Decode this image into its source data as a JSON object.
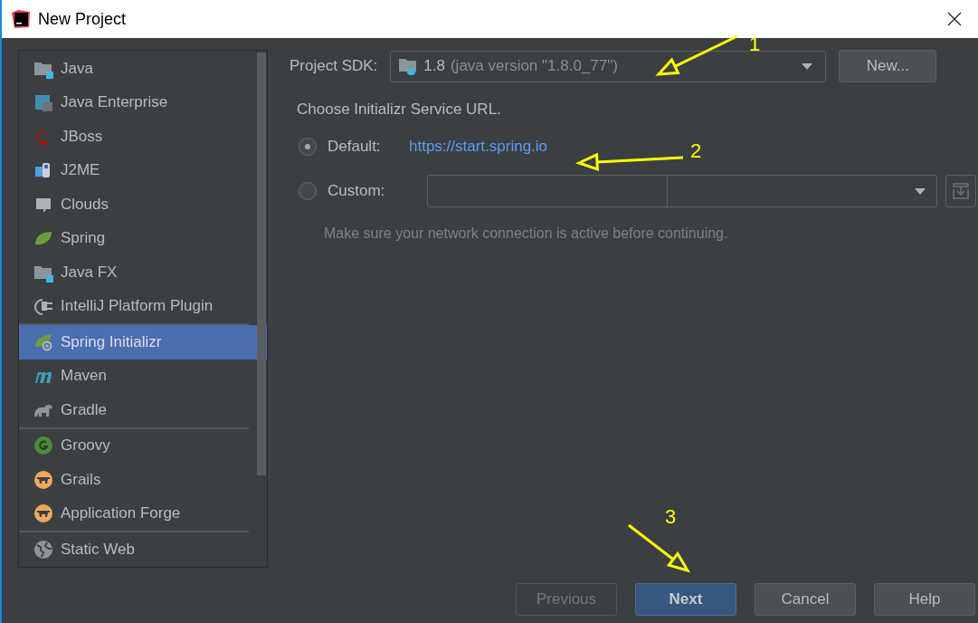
{
  "window": {
    "title": "New Project"
  },
  "sidebar": {
    "groups": [
      {
        "items": [
          {
            "label": "Java",
            "kind": "folder",
            "selected": false
          },
          {
            "label": "Java Enterprise",
            "kind": "enterprise",
            "selected": false
          },
          {
            "label": "JBoss",
            "kind": "jboss",
            "selected": false
          },
          {
            "label": "J2ME",
            "kind": "j2me",
            "selected": false
          },
          {
            "label": "Clouds",
            "kind": "clouds",
            "selected": false
          },
          {
            "label": "Spring",
            "kind": "spring",
            "selected": false
          },
          {
            "label": "Java FX",
            "kind": "folder",
            "selected": false
          },
          {
            "label": "IntelliJ Platform Plugin",
            "kind": "plugin",
            "selected": false
          }
        ]
      },
      {
        "items": [
          {
            "label": "Spring Initializr",
            "kind": "initializr",
            "selected": true
          },
          {
            "label": "Maven",
            "kind": "maven",
            "selected": false
          },
          {
            "label": "Gradle",
            "kind": "gradle",
            "selected": false
          }
        ]
      },
      {
        "items": [
          {
            "label": "Groovy",
            "kind": "groovy",
            "selected": false
          },
          {
            "label": "Grails",
            "kind": "grails",
            "selected": false
          },
          {
            "label": "Application Forge",
            "kind": "grails",
            "selected": false
          }
        ]
      },
      {
        "items": [
          {
            "label": "Static Web",
            "kind": "web",
            "selected": false
          }
        ]
      }
    ]
  },
  "sdk": {
    "label": "Project SDK:",
    "version": "1.8",
    "detail": "(java version \"1.8.0_77\")",
    "new_button": "New..."
  },
  "service_url": {
    "heading": "Choose Initializr Service URL.",
    "options": [
      {
        "label": "Default:",
        "selected": true,
        "link": "https://start.spring.io"
      },
      {
        "label": "Custom:",
        "selected": false
      }
    ],
    "hint": "Make sure your network connection is active before continuing."
  },
  "buttons": [
    {
      "label": "Previous",
      "kind": "disabled"
    },
    {
      "label": "Next",
      "kind": "default"
    },
    {
      "label": "Cancel",
      "kind": "normal"
    },
    {
      "label": "Help",
      "kind": "normal"
    }
  ],
  "annotations": [
    {
      "label": "1"
    },
    {
      "label": "2"
    },
    {
      "label": "3"
    }
  ]
}
